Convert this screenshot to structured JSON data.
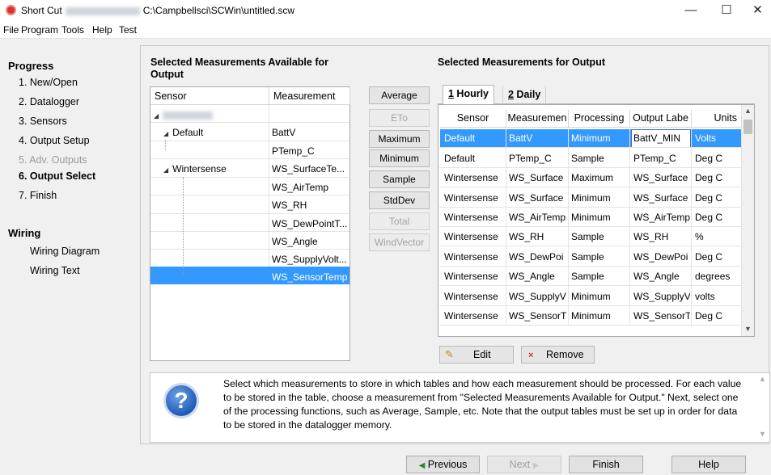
{
  "window": {
    "title_prefix": "Short Cut",
    "title_path": "C:\\Campbellsci\\SCWin\\untitled.scw",
    "minimize_glyph": "—",
    "maximize_glyph": "☐",
    "close_glyph": "✕"
  },
  "menu": [
    "File",
    "Program",
    "Tools",
    "Help",
    "Test"
  ],
  "sidebar": {
    "progress_title": "Progress",
    "steps": [
      {
        "label": "1. New/Open",
        "state": "normal"
      },
      {
        "label": "2. Datalogger",
        "state": "normal"
      },
      {
        "label": "3. Sensors",
        "state": "normal"
      },
      {
        "label": "4. Output Setup",
        "state": "normal"
      },
      {
        "label": "5. Adv. Outputs",
        "state": "disabled"
      },
      {
        "label": "6. Output Select",
        "state": "active"
      },
      {
        "label": "7. Finish",
        "state": "normal"
      }
    ],
    "wiring_title": "Wiring",
    "wiring_items": [
      "Wiring Diagram",
      "Wiring Text"
    ]
  },
  "available": {
    "header": "Selected Measurements Available for Output",
    "col_sensor": "Sensor",
    "col_measurement": "Measurement",
    "rows": [
      {
        "sensor": "",
        "measurement": ""
      },
      {
        "sensor": "Default",
        "measurement": "BattV"
      },
      {
        "sensor": "",
        "measurement": "PTemp_C"
      },
      {
        "sensor": "Wintersense",
        "measurement": "WS_SurfaceTe..."
      },
      {
        "sensor": "",
        "measurement": "WS_AirTemp"
      },
      {
        "sensor": "",
        "measurement": "WS_RH"
      },
      {
        "sensor": "",
        "measurement": "WS_DewPointT..."
      },
      {
        "sensor": "",
        "measurement": "WS_Angle"
      },
      {
        "sensor": "",
        "measurement": "WS_SupplyVolt..."
      },
      {
        "sensor": "",
        "measurement": "WS_SensorTemp"
      }
    ]
  },
  "processing_buttons": [
    {
      "label": "Average",
      "enabled": true
    },
    {
      "label": "ETo",
      "enabled": false
    },
    {
      "label": "Maximum",
      "enabled": true
    },
    {
      "label": "Minimum",
      "enabled": true
    },
    {
      "label": "Sample",
      "enabled": true
    },
    {
      "label": "StdDev",
      "enabled": true
    },
    {
      "label": "Total",
      "enabled": false
    },
    {
      "label": "WindVector",
      "enabled": false
    }
  ],
  "output": {
    "header": "Selected Measurements for Output",
    "tabs": [
      {
        "key": "1",
        "label": " Hourly"
      },
      {
        "key": "2",
        "label": " Daily"
      }
    ],
    "columns": [
      "Sensor",
      "Measuremen",
      "Processing",
      "Output Labe",
      "Units"
    ],
    "rows": [
      {
        "sensor": "Default",
        "measurement": "BattV",
        "processing": "Minimum",
        "label": "BattV_MIN",
        "units": "Volts"
      },
      {
        "sensor": "Default",
        "measurement": "PTemp_C",
        "processing": "Sample",
        "label": "PTemp_C",
        "units": "Deg C"
      },
      {
        "sensor": "Wintersense",
        "measurement": "WS_Surface",
        "processing": "Maximum",
        "label": "WS_Surface",
        "units": "Deg C"
      },
      {
        "sensor": "Wintersense",
        "measurement": "WS_Surface",
        "processing": "Minimum",
        "label": "WS_Surface",
        "units": "Deg C"
      },
      {
        "sensor": "Wintersense",
        "measurement": "WS_AirTemp",
        "processing": "Minimum",
        "label": "WS_AirTemp",
        "units": "Deg C"
      },
      {
        "sensor": "Wintersense",
        "measurement": "WS_RH",
        "processing": "Sample",
        "label": "WS_RH",
        "units": "%"
      },
      {
        "sensor": "Wintersense",
        "measurement": "WS_DewPoi",
        "processing": "Sample",
        "label": "WS_DewPoi",
        "units": "Deg C"
      },
      {
        "sensor": "Wintersense",
        "measurement": "WS_Angle",
        "processing": "Sample",
        "label": "WS_Angle",
        "units": "degrees"
      },
      {
        "sensor": "Wintersense",
        "measurement": "WS_SupplyV",
        "processing": "Minimum",
        "label": "WS_SupplyV",
        "units": "volts"
      },
      {
        "sensor": "Wintersense",
        "measurement": "WS_SensorT",
        "processing": "Minimum",
        "label": "WS_SensorT",
        "units": "Deg C"
      }
    ],
    "edit_label": "Edit",
    "remove_label": "Remove"
  },
  "help": {
    "text": "Select which measurements to store in which tables and how each measurement should be processed. For each value to be stored in the table, choose a measurement from \"Selected Measurements Available for Output.\"  Next, select one of the processing functions, such as Average, Sample, etc. Note that the output tables must be set up in order for data to be stored in the datalogger memory.",
    "icon_glyph": "?"
  },
  "nav": {
    "previous": "Previous",
    "next": "Next",
    "finish": "Finish",
    "help": "Help"
  },
  "colors": {
    "selection": "#3399ff",
    "window_bg": "#f0f0f0",
    "app_icon": "#d9342b"
  }
}
